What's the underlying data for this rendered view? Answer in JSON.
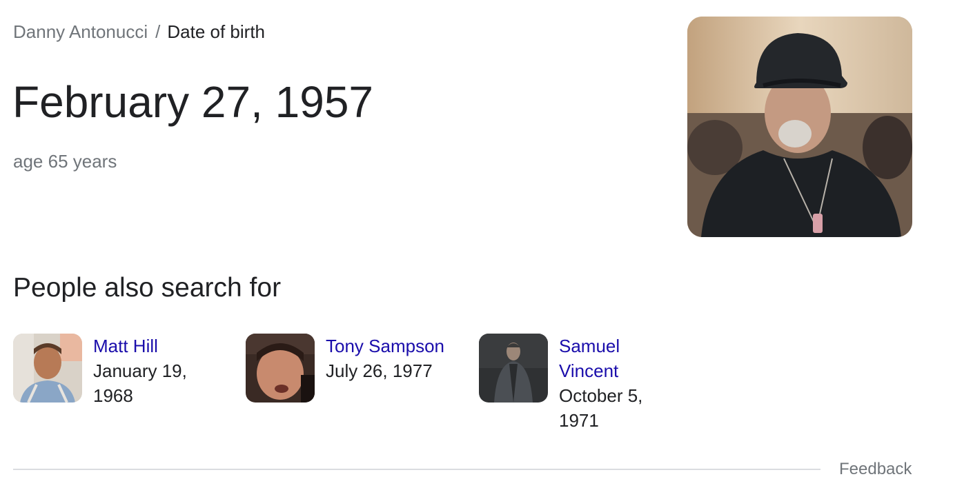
{
  "breadcrumb": {
    "parent": "Danny Antonucci",
    "separator": "/",
    "current": "Date of birth"
  },
  "answer": {
    "value": "February 27, 1957",
    "subtext": "age 65 years"
  },
  "section": {
    "title": "People also search for"
  },
  "people": [
    {
      "name": "Matt Hill",
      "date": "January 19, 1968"
    },
    {
      "name": "Tony Sampson",
      "date": "July 26, 1977"
    },
    {
      "name": "Samuel Vincent",
      "date": "October 5, 1971"
    }
  ],
  "footer": {
    "feedback": "Feedback"
  },
  "colors": {
    "link": "#1a0dab",
    "primary_text": "#202124",
    "secondary_text": "#70757a",
    "divider": "#dadce0"
  }
}
